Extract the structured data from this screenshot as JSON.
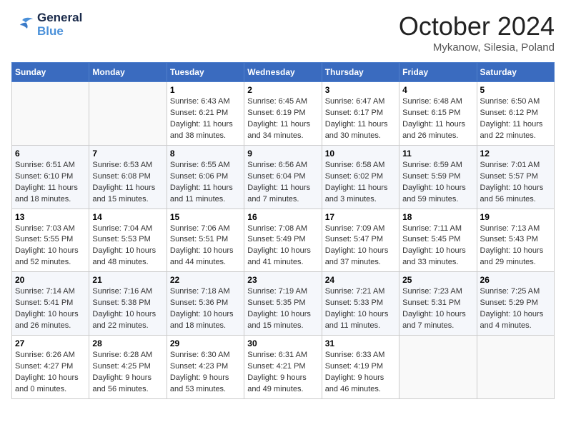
{
  "logo": {
    "line1": "General",
    "line2": "Blue"
  },
  "title": "October 2024",
  "location": "Mykanow, Silesia, Poland",
  "weekdays": [
    "Sunday",
    "Monday",
    "Tuesday",
    "Wednesday",
    "Thursday",
    "Friday",
    "Saturday"
  ],
  "weeks": [
    [
      {
        "day": "",
        "sunrise": "",
        "sunset": "",
        "daylight": ""
      },
      {
        "day": "",
        "sunrise": "",
        "sunset": "",
        "daylight": ""
      },
      {
        "day": "1",
        "sunrise": "Sunrise: 6:43 AM",
        "sunset": "Sunset: 6:21 PM",
        "daylight": "Daylight: 11 hours and 38 minutes."
      },
      {
        "day": "2",
        "sunrise": "Sunrise: 6:45 AM",
        "sunset": "Sunset: 6:19 PM",
        "daylight": "Daylight: 11 hours and 34 minutes."
      },
      {
        "day": "3",
        "sunrise": "Sunrise: 6:47 AM",
        "sunset": "Sunset: 6:17 PM",
        "daylight": "Daylight: 11 hours and 30 minutes."
      },
      {
        "day": "4",
        "sunrise": "Sunrise: 6:48 AM",
        "sunset": "Sunset: 6:15 PM",
        "daylight": "Daylight: 11 hours and 26 minutes."
      },
      {
        "day": "5",
        "sunrise": "Sunrise: 6:50 AM",
        "sunset": "Sunset: 6:12 PM",
        "daylight": "Daylight: 11 hours and 22 minutes."
      }
    ],
    [
      {
        "day": "6",
        "sunrise": "Sunrise: 6:51 AM",
        "sunset": "Sunset: 6:10 PM",
        "daylight": "Daylight: 11 hours and 18 minutes."
      },
      {
        "day": "7",
        "sunrise": "Sunrise: 6:53 AM",
        "sunset": "Sunset: 6:08 PM",
        "daylight": "Daylight: 11 hours and 15 minutes."
      },
      {
        "day": "8",
        "sunrise": "Sunrise: 6:55 AM",
        "sunset": "Sunset: 6:06 PM",
        "daylight": "Daylight: 11 hours and 11 minutes."
      },
      {
        "day": "9",
        "sunrise": "Sunrise: 6:56 AM",
        "sunset": "Sunset: 6:04 PM",
        "daylight": "Daylight: 11 hours and 7 minutes."
      },
      {
        "day": "10",
        "sunrise": "Sunrise: 6:58 AM",
        "sunset": "Sunset: 6:02 PM",
        "daylight": "Daylight: 11 hours and 3 minutes."
      },
      {
        "day": "11",
        "sunrise": "Sunrise: 6:59 AM",
        "sunset": "Sunset: 5:59 PM",
        "daylight": "Daylight: 10 hours and 59 minutes."
      },
      {
        "day": "12",
        "sunrise": "Sunrise: 7:01 AM",
        "sunset": "Sunset: 5:57 PM",
        "daylight": "Daylight: 10 hours and 56 minutes."
      }
    ],
    [
      {
        "day": "13",
        "sunrise": "Sunrise: 7:03 AM",
        "sunset": "Sunset: 5:55 PM",
        "daylight": "Daylight: 10 hours and 52 minutes."
      },
      {
        "day": "14",
        "sunrise": "Sunrise: 7:04 AM",
        "sunset": "Sunset: 5:53 PM",
        "daylight": "Daylight: 10 hours and 48 minutes."
      },
      {
        "day": "15",
        "sunrise": "Sunrise: 7:06 AM",
        "sunset": "Sunset: 5:51 PM",
        "daylight": "Daylight: 10 hours and 44 minutes."
      },
      {
        "day": "16",
        "sunrise": "Sunrise: 7:08 AM",
        "sunset": "Sunset: 5:49 PM",
        "daylight": "Daylight: 10 hours and 41 minutes."
      },
      {
        "day": "17",
        "sunrise": "Sunrise: 7:09 AM",
        "sunset": "Sunset: 5:47 PM",
        "daylight": "Daylight: 10 hours and 37 minutes."
      },
      {
        "day": "18",
        "sunrise": "Sunrise: 7:11 AM",
        "sunset": "Sunset: 5:45 PM",
        "daylight": "Daylight: 10 hours and 33 minutes."
      },
      {
        "day": "19",
        "sunrise": "Sunrise: 7:13 AM",
        "sunset": "Sunset: 5:43 PM",
        "daylight": "Daylight: 10 hours and 29 minutes."
      }
    ],
    [
      {
        "day": "20",
        "sunrise": "Sunrise: 7:14 AM",
        "sunset": "Sunset: 5:41 PM",
        "daylight": "Daylight: 10 hours and 26 minutes."
      },
      {
        "day": "21",
        "sunrise": "Sunrise: 7:16 AM",
        "sunset": "Sunset: 5:38 PM",
        "daylight": "Daylight: 10 hours and 22 minutes."
      },
      {
        "day": "22",
        "sunrise": "Sunrise: 7:18 AM",
        "sunset": "Sunset: 5:36 PM",
        "daylight": "Daylight: 10 hours and 18 minutes."
      },
      {
        "day": "23",
        "sunrise": "Sunrise: 7:19 AM",
        "sunset": "Sunset: 5:35 PM",
        "daylight": "Daylight: 10 hours and 15 minutes."
      },
      {
        "day": "24",
        "sunrise": "Sunrise: 7:21 AM",
        "sunset": "Sunset: 5:33 PM",
        "daylight": "Daylight: 10 hours and 11 minutes."
      },
      {
        "day": "25",
        "sunrise": "Sunrise: 7:23 AM",
        "sunset": "Sunset: 5:31 PM",
        "daylight": "Daylight: 10 hours and 7 minutes."
      },
      {
        "day": "26",
        "sunrise": "Sunrise: 7:25 AM",
        "sunset": "Sunset: 5:29 PM",
        "daylight": "Daylight: 10 hours and 4 minutes."
      }
    ],
    [
      {
        "day": "27",
        "sunrise": "Sunrise: 6:26 AM",
        "sunset": "Sunset: 4:27 PM",
        "daylight": "Daylight: 10 hours and 0 minutes."
      },
      {
        "day": "28",
        "sunrise": "Sunrise: 6:28 AM",
        "sunset": "Sunset: 4:25 PM",
        "daylight": "Daylight: 9 hours and 56 minutes."
      },
      {
        "day": "29",
        "sunrise": "Sunrise: 6:30 AM",
        "sunset": "Sunset: 4:23 PM",
        "daylight": "Daylight: 9 hours and 53 minutes."
      },
      {
        "day": "30",
        "sunrise": "Sunrise: 6:31 AM",
        "sunset": "Sunset: 4:21 PM",
        "daylight": "Daylight: 9 hours and 49 minutes."
      },
      {
        "day": "31",
        "sunrise": "Sunrise: 6:33 AM",
        "sunset": "Sunset: 4:19 PM",
        "daylight": "Daylight: 9 hours and 46 minutes."
      },
      {
        "day": "",
        "sunrise": "",
        "sunset": "",
        "daylight": ""
      },
      {
        "day": "",
        "sunrise": "",
        "sunset": "",
        "daylight": ""
      }
    ]
  ]
}
